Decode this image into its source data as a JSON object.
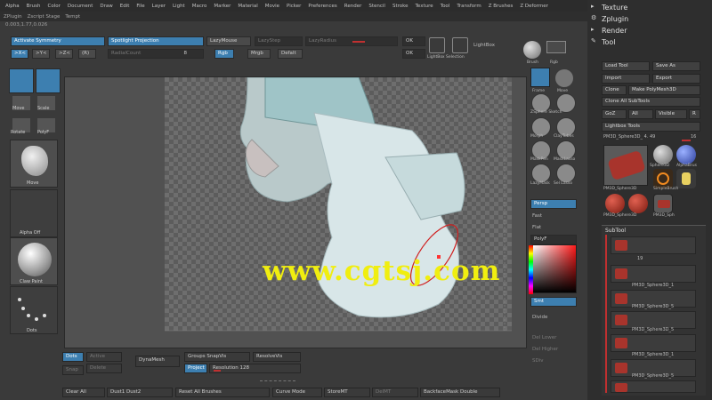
{
  "menu": [
    "Alpha",
    "Brush",
    "Color",
    "Document",
    "Draw",
    "Edit",
    "File",
    "Layer",
    "Light",
    "Macro",
    "Marker",
    "Material",
    "Movie",
    "Picker",
    "Preferences",
    "Render",
    "Stencil",
    "Stroke",
    "Texture",
    "Tool",
    "Transform",
    "Z Brushes",
    "Z Deformer"
  ],
  "subbar": [
    "ZPlugin",
    "Zscript Stage",
    "Tempt"
  ],
  "coords": "0.003,1.77,0.026",
  "top": {
    "activate_symmetry": "Activate Symmetry",
    "spotlight_projection": "Spotlight Projection",
    "lazymouse": "LazyMouse",
    "lazystep": "LazyStep",
    "lazyradius": "LazyRadius",
    "x_btn": ">X<",
    "y_btn": ">Y<",
    "z_btn": ">Z<",
    "r_btn": "(R)",
    "radialcount": "RadialCount",
    "radial_value": "8",
    "rgb": "Rgb",
    "mrgb": "Mrgb",
    "defalt": "Defalt",
    "ok_top": "OK",
    "ok_bot": "OK",
    "lightbox": "LightBox",
    "lightbox_sub": "LightBox Selection",
    "brush_label": "Brush",
    "rgb_label": "Rgb"
  },
  "left": {
    "move": "Move",
    "scale": "Scale",
    "rotate": "Rotate",
    "polyf": "PolyF",
    "material_lbl": "Move",
    "alpha_lbl": "Alpha Off",
    "texture_lbl": "Claw Paint",
    "stroke_lbl": "Dots"
  },
  "watermark": "www.cgtsj.com",
  "rstrip": {
    "frame": "Frame",
    "move_icon": "Move",
    "sculptris": "ZSphere Sketch",
    "morph": "Morph",
    "clay": "ClayTubes",
    "mask": "MaskPen",
    "masked": "MaskLasso",
    "lazymask": "LazyMask",
    "selectlasso": "Sel Lasso",
    "persp": "Persp",
    "floor": "Floor",
    "fast": "Fast",
    "flat": "Flat",
    "polyf": "PolyF",
    "divide": "Divide",
    "del_lower": "Del Lower",
    "del_higher": "Del Higher",
    "sdiv": "SDiv"
  },
  "rpanel": {
    "texture": "Texture",
    "zplugin": "Zplugin",
    "render": "Render",
    "tool": "Tool",
    "load_tool": "Load Tool",
    "save_as": "Save As",
    "import": "Import",
    "export": "Export",
    "clone": "Clone",
    "make_polymesh": "Make PolyMesh3D",
    "clone_all": "Clone All SubTools",
    "goz": "GoZ",
    "all": "All",
    "visible": "Visible",
    "r": "R",
    "lightbox_tools": "Lightbox Tools",
    "pm3d_label": "PM3D_Sphere3D_ 4. 49",
    "value": "16",
    "thumbs": [
      "PM3D_Sphere3D",
      "Sphere3D",
      "AlphaBrus",
      "ZSphere",
      "SimpleBrush",
      "PM3D_Sphere3D",
      "PM3D_Sph"
    ],
    "subtool": "SubTool",
    "sub_count": "19",
    "sub_items": [
      "PM3D_Sphere3D_1",
      "PM3D_Sphere3D_5",
      "PM3D_Sphere3D_5",
      "PM3D_Sphere3D_1",
      "PM3D_Sphere3D_5"
    ]
  },
  "bottom": {
    "dots": "Dots",
    "active": "Active",
    "snap": "Snap",
    "delete": "Delete",
    "dynamesh": "DynaMesh",
    "groups_split": "Groups SnapVis",
    "resolve": "ResolveVis",
    "project": "Project",
    "resolution": "Resolution 128",
    "clear_all": "Clear All",
    "dust": "Dust1 Dust2",
    "reset_brushes": "Reset All Brushes",
    "curve_mode": "Curve Mode",
    "storemt": "StoreMT",
    "delmt": "DelMT",
    "backface": "BackfaceMask Double"
  }
}
